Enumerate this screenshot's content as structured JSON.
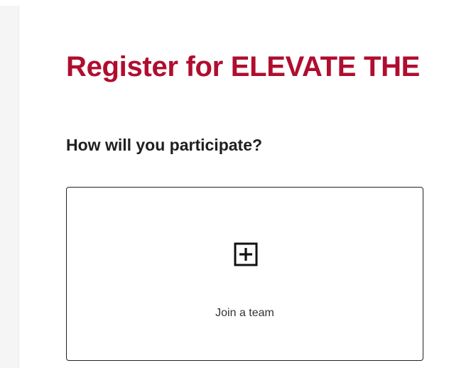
{
  "page": {
    "title": "Register for ELEVATE THE",
    "section_heading": "How will you participate?"
  },
  "options": [
    {
      "label": "Join a team",
      "icon": "plus-square-icon"
    }
  ],
  "colors": {
    "title": "#b00d2f",
    "heading": "#1f1f1f",
    "card_border": "#222222",
    "rail": "#f5f5f5"
  }
}
